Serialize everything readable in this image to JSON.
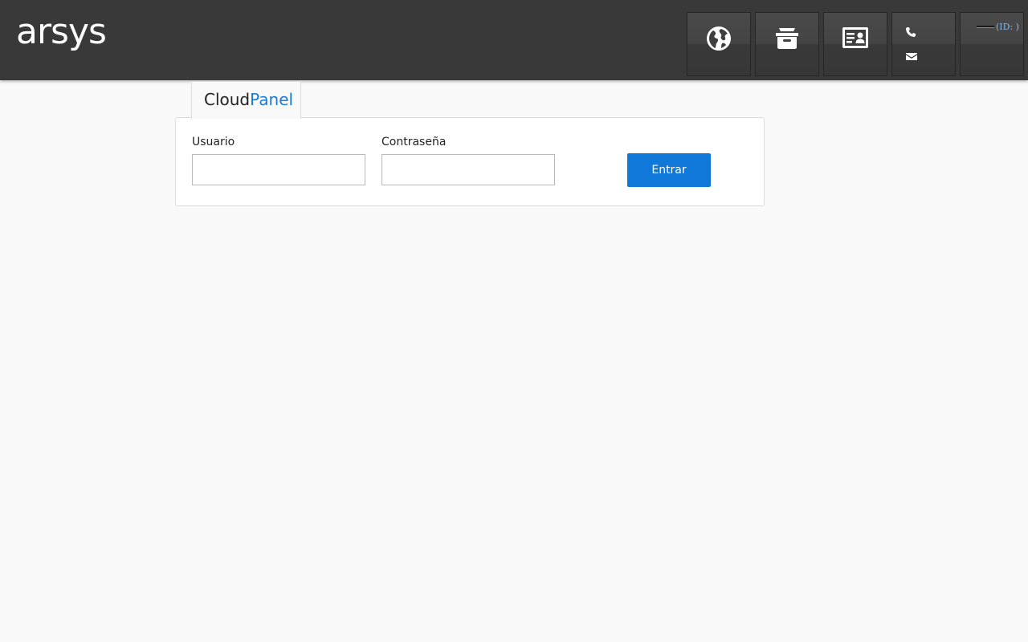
{
  "header": {
    "logo_text": "arsys",
    "nav": [
      {
        "name": "domains",
        "icon": "globe-icon"
      },
      {
        "name": "shop",
        "icon": "archive-box-icon"
      },
      {
        "name": "account",
        "icon": "id-card-icon"
      },
      {
        "name": "contact",
        "icons": [
          "phone-icon",
          "envelope-icon"
        ]
      },
      {
        "name": "user",
        "id_text": "(ID: )"
      }
    ]
  },
  "tab": {
    "cloud": "Cloud",
    "panel": "Panel"
  },
  "login": {
    "user_label": "Usuario",
    "user_value": "",
    "password_label": "Contraseña",
    "password_value": "",
    "submit_label": "Entrar"
  },
  "colors": {
    "header_bg": "#393939",
    "accent": "#0f78d8",
    "panel_word": "#1a7bd2",
    "page_bg": "#f9f9f9"
  }
}
